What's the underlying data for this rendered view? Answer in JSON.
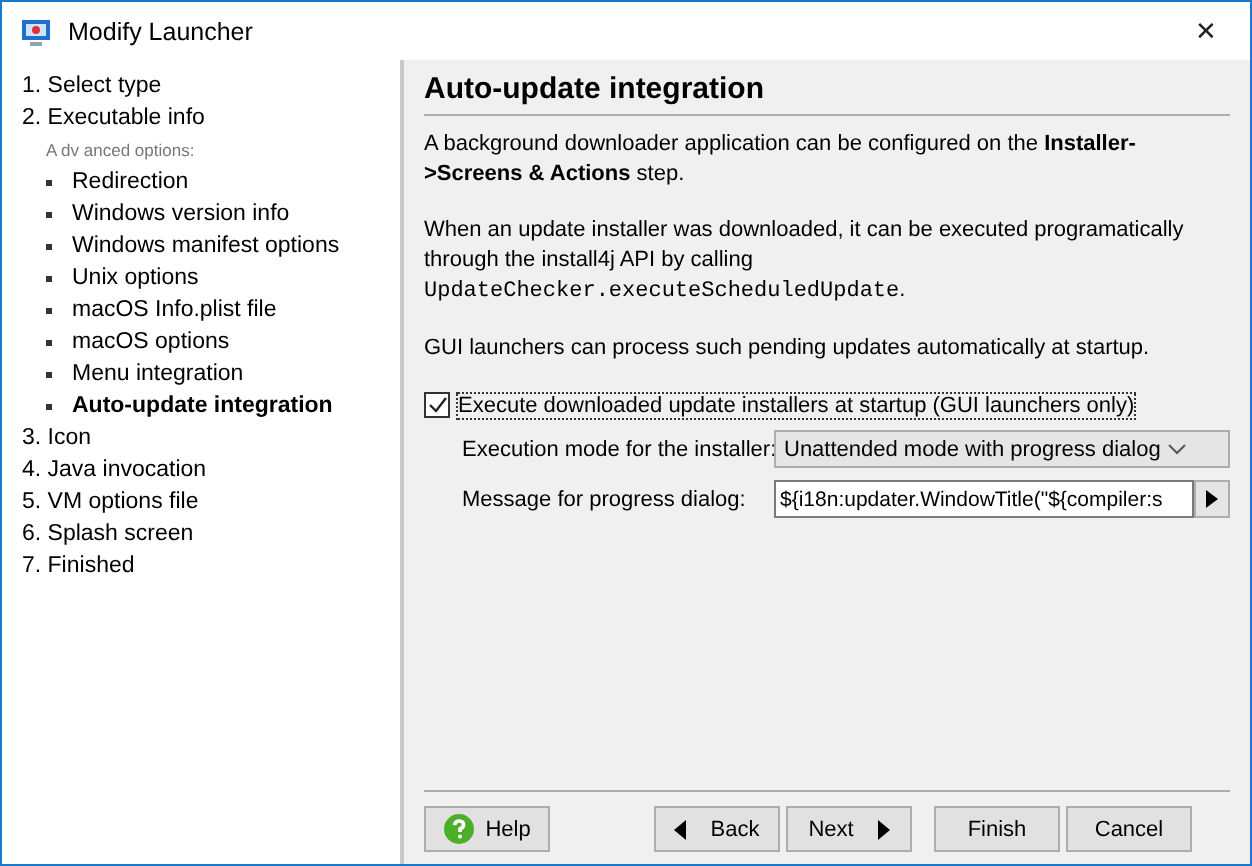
{
  "window": {
    "title": "Modify Launcher",
    "close": "✕"
  },
  "nav": {
    "items": [
      {
        "kind": "step",
        "label": "1. Select type",
        "selected": false
      },
      {
        "kind": "step",
        "label": "2. Executable info",
        "selected": false
      },
      {
        "kind": "heading",
        "label": "A dv anced options:",
        "selected": false
      },
      {
        "kind": "bullet",
        "label": "Redirection",
        "selected": false
      },
      {
        "kind": "bullet",
        "label": "Windows version info",
        "selected": false
      },
      {
        "kind": "bullet",
        "label": "Windows manifest options",
        "selected": false
      },
      {
        "kind": "bullet",
        "label": "Unix options",
        "selected": false
      },
      {
        "kind": "bullet",
        "label": "macOS Info.plist file",
        "selected": false
      },
      {
        "kind": "bullet",
        "label": "macOS options",
        "selected": false
      },
      {
        "kind": "bullet",
        "label": "Menu integration",
        "selected": false
      },
      {
        "kind": "bullet",
        "label": "Auto-update integration",
        "selected": true
      },
      {
        "kind": "step",
        "label": "3. Icon",
        "selected": false
      },
      {
        "kind": "step",
        "label": "4. Java invocation",
        "selected": false
      },
      {
        "kind": "step",
        "label": "5. VM options file",
        "selected": false
      },
      {
        "kind": "step",
        "label": "6. Splash screen",
        "selected": false
      },
      {
        "kind": "step",
        "label": "7. Finished",
        "selected": false
      }
    ]
  },
  "panel": {
    "title": "Auto-update integration",
    "paragraphs": [
      {
        "text": "A background downloader application can be configured on the **Installer->Screens & Actions** step."
      },
      {
        "text": "When an update installer was downloaded, it can be executed programatically through the install4j API by calling",
        "code": "UpdateChecker.executeScheduledUpdate",
        "after": "."
      },
      {
        "text": "GUI launchers can process such pending updates automatically at startup."
      }
    ],
    "checkbox": {
      "label": "Execute downloaded update installers at startup (GUI launchers only)",
      "checked": true
    },
    "mode": {
      "label": "Execution mode for the installer:",
      "value": "Unattended mode with progress dialog"
    },
    "message": {
      "label": "Message for progress dialog:",
      "value": "${i18n:updater.WindowTitle(\"${compiler:s"
    }
  },
  "buttons": [
    {
      "kind": "help",
      "label": "Help"
    },
    {
      "kind": "back",
      "label": "Back"
    },
    {
      "kind": "next",
      "label": "Next"
    },
    {
      "kind": "plain",
      "label": "Finish"
    },
    {
      "kind": "plain",
      "label": "Cancel"
    }
  ]
}
